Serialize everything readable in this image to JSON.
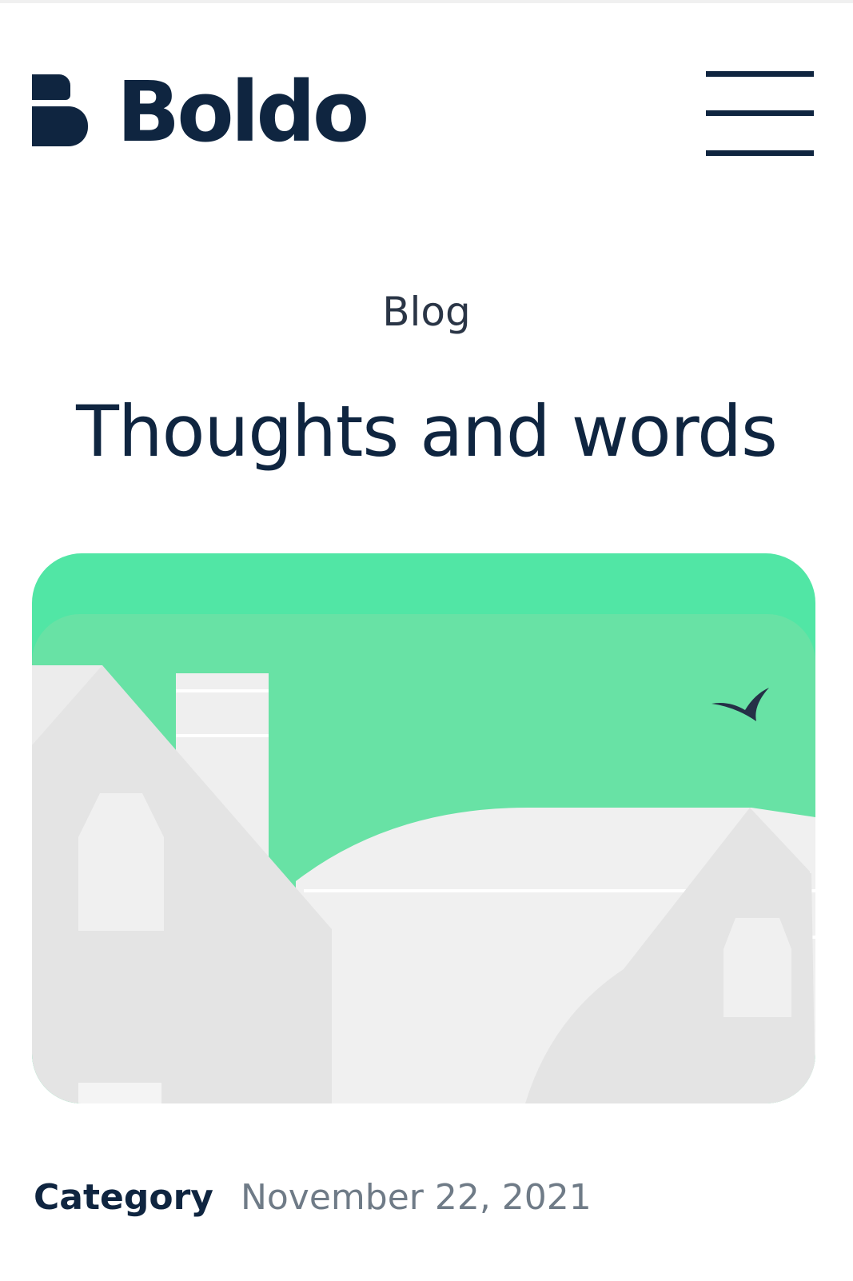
{
  "header": {
    "brand_name": "Boldo",
    "logo_icon": "boldo-logo-icon",
    "menu_icon": "hamburger-menu-icon"
  },
  "hero": {
    "eyebrow": "Blog",
    "title": "Thoughts and words"
  },
  "post": {
    "image_description_icon": "houses-illustration",
    "category": "Category",
    "date": "November 22, 2021"
  },
  "colors": {
    "navy": "#0f2540",
    "sky_top": "#51e6a5",
    "sky": "#68e2a5",
    "house_gray": "#e4e4e4",
    "house_light": "#f0f0f0",
    "meta_gray": "#6f7b87"
  }
}
